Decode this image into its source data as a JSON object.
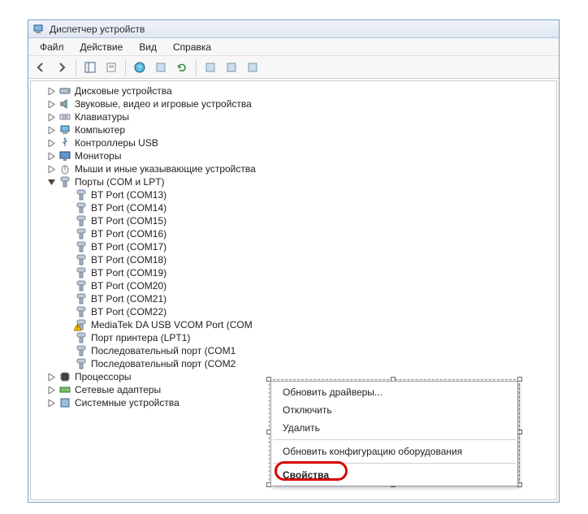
{
  "window": {
    "title": "Диспетчер устройств"
  },
  "menubar": {
    "file": "Файл",
    "action": "Действие",
    "view": "Вид",
    "help": "Справка"
  },
  "tree": {
    "disk": {
      "label": "Дисковые устройства"
    },
    "audio": {
      "label": "Звуковые, видео и игровые устройства"
    },
    "keyboard": {
      "label": "Клавиатуры"
    },
    "computer": {
      "label": "Компьютер"
    },
    "usb": {
      "label": "Контроллеры USB"
    },
    "monitor": {
      "label": "Мониторы"
    },
    "mouse": {
      "label": "Мыши и иные указывающие устройства"
    },
    "ports": {
      "label": "Порты (COM и LPT)",
      "children": {
        "bt13": "BT Port (COM13)",
        "bt14": "BT Port (COM14)",
        "bt15": "BT Port (COM15)",
        "bt16": "BT Port (COM16)",
        "bt17": "BT Port (COM17)",
        "bt18": "BT Port (COM18)",
        "bt19": "BT Port (COM19)",
        "bt20": "BT Port (COM20)",
        "bt21": "BT Port (COM21)",
        "bt22": "BT Port (COM22)",
        "mtk_truncated": "MediaTek DA USB VCOM Port (COM",
        "lpt1": "Порт принтера (LPT1)",
        "com1_truncated": "Последовательный порт (COM1",
        "com2_truncated": "Последовательный порт (COM2"
      }
    },
    "cpu": {
      "label": "Процессоры"
    },
    "net": {
      "label": "Сетевые адаптеры"
    },
    "system": {
      "label": "Системные устройства"
    }
  },
  "context_menu": {
    "update_drivers": "Обновить драйверы...",
    "disable": "Отключить",
    "uninstall": "Удалить",
    "scan": "Обновить конфигурацию оборудования",
    "properties": "Свойства"
  }
}
